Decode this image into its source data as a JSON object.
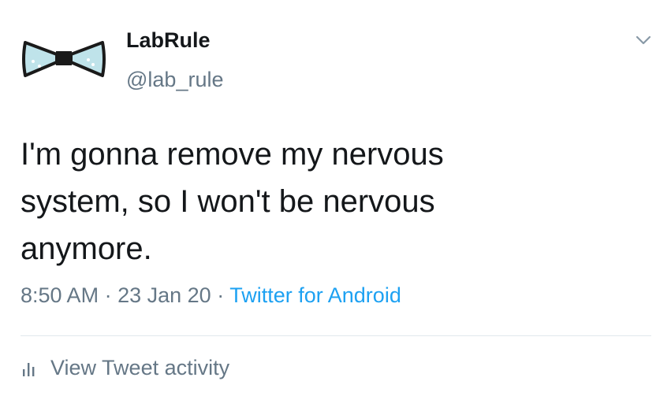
{
  "tweet": {
    "author": {
      "name": "LabRule",
      "handle": "@lab_rule",
      "avatar_icon": "bow-tie-icon"
    },
    "text_lines": [
      "I'm gonna remove my nervous",
      "system, so I won't be nervous",
      "anymore."
    ],
    "time": "8:50 AM",
    "separator": "·",
    "date": "23 Jan 20",
    "source": "Twitter for Android",
    "activity_label": "View Tweet activity",
    "activity_icon": "bar-chart-icon",
    "menu_icon": "chevron-down-icon"
  },
  "colors": {
    "text": "#14171a",
    "secondary": "#657786",
    "link": "#1da1f2",
    "divider": "#e1e8ed",
    "avatar_fill": "#bfe3ea"
  }
}
